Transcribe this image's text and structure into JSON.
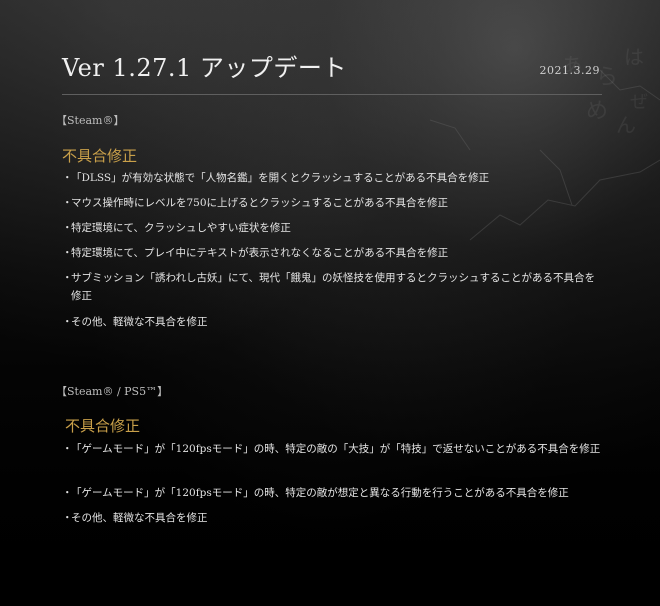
{
  "header": {
    "title": "Ver 1.27.1 アップデート",
    "date": "2021.3.29"
  },
  "sections": [
    {
      "platform": "【Steam®】",
      "heading": "不具合修正",
      "items": [
        "「DLSS」が有効な状態で「人物名鑑」を開くとクラッシュすることがある不具合を修正",
        "マウス操作時にレベルを750に上げるとクラッシュすることがある不具合を修正",
        "特定環境にて、クラッシュしやすい症状を修正",
        "特定環境にて、プレイ中にテキストが表示されなくなることがある不具合を修正",
        "サブミッション「誘われし古妖」にて、現代「餓鬼」の妖怪技を使用するとクラッシュすることがある不具合を修正",
        "その他、軽微な不具合を修正"
      ]
    },
    {
      "platform": "【Steam® / PS5™】",
      "heading": "不具合修正",
      "items": [
        "「ゲームモード」が「120fpsモード」の時、特定の敵の「大技」が「特技」で返せないことがある不具合を修正",
        "「ゲームモード」が「120fpsモード」の時、特定の敵が想定と異なる行動を行うことがある不具合を修正",
        "その他、軽微な不具合を修正"
      ]
    }
  ],
  "bullet": "・"
}
